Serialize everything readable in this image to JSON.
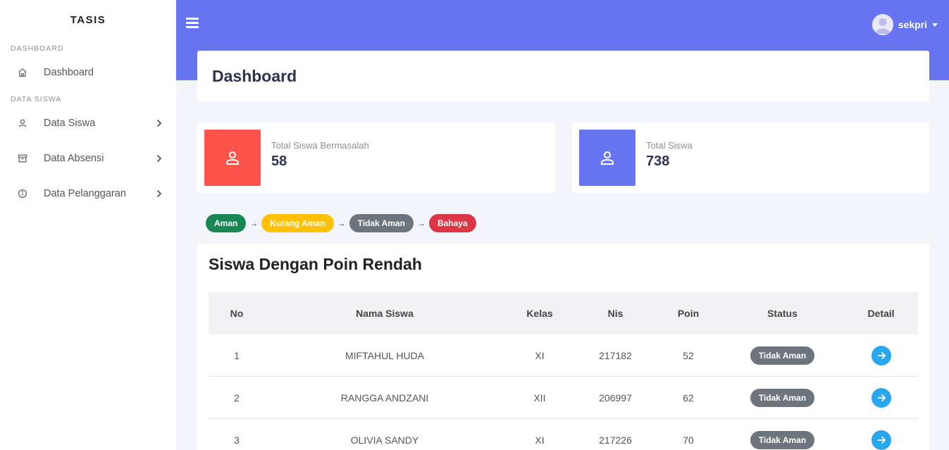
{
  "brand": "TASIS",
  "sidebar": {
    "sections": [
      {
        "label": "DASHBOARD",
        "items": [
          {
            "label": "Dashboard",
            "icon": "home-icon"
          }
        ]
      },
      {
        "label": "DATA SISWA",
        "items": [
          {
            "label": "Data Siswa",
            "icon": "user-icon"
          },
          {
            "label": "Data Absensi",
            "icon": "archive-icon"
          },
          {
            "label": "Data Pelanggaran",
            "icon": "info-icon"
          }
        ]
      }
    ]
  },
  "topbar": {
    "user_name": "sekpri"
  },
  "page": {
    "title": "Dashboard"
  },
  "stats": [
    {
      "label": "Total Siswa Bermasalah",
      "value": "58",
      "color": "#fc544b"
    },
    {
      "label": "Total Siswa",
      "value": "738",
      "color": "#6776f0"
    }
  ],
  "legend": {
    "items": [
      {
        "label": "Aman",
        "color": "#198754"
      },
      {
        "label": "Kurang Aman",
        "color": "#ffc107"
      },
      {
        "label": "Tidak Aman",
        "color": "#6c757d"
      },
      {
        "label": "Bahaya",
        "color": "#dc3545"
      }
    ],
    "arrow": "→"
  },
  "table": {
    "title": "Siswa Dengan Poin Rendah",
    "headers": {
      "no": "No",
      "nama": "Nama Siswa",
      "kelas": "Kelas",
      "nis": "Nis",
      "poin": "Poin",
      "status": "Status",
      "detail": "Detail"
    },
    "rows": [
      {
        "no": "1",
        "nama": "MIFTAHUL HUDA",
        "kelas": "XI",
        "nis": "217182",
        "poin": "52",
        "status": "Tidak Aman"
      },
      {
        "no": "2",
        "nama": "RANGGA ANDZANI",
        "kelas": "XII",
        "nis": "206997",
        "poin": "62",
        "status": "Tidak Aman"
      },
      {
        "no": "3",
        "nama": "OLIVIA SANDY",
        "kelas": "XI",
        "nis": "217226",
        "poin": "70",
        "status": "Tidak Aman"
      }
    ]
  }
}
